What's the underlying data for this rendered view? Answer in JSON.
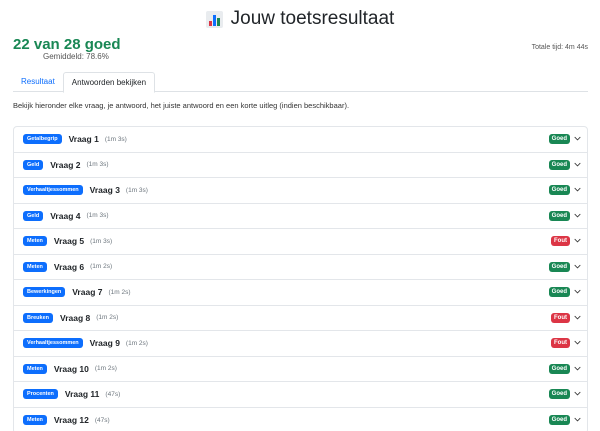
{
  "header": {
    "title": "Jouw toetsresultaat",
    "icon": "bar-chart-icon",
    "score_text": "22 van 28 goed",
    "average_text": "Gemiddeld: 78.6%",
    "total_time_text": "Totale tijd: 4m 44s"
  },
  "tabs": [
    {
      "label": "Resultaat",
      "active": false
    },
    {
      "label": "Antwoorden bekijken",
      "active": true
    }
  ],
  "intro_text": "Bekijk hieronder elke vraag, je antwoord, het juiste antwoord en een korte uitleg (indien beschikbaar).",
  "questions": [
    {
      "category": "Getalbegrip",
      "label": "Vraag 1",
      "time": "(1m 3s)",
      "result": "Goed",
      "correct": true
    },
    {
      "category": "Geld",
      "label": "Vraag 2",
      "time": "(1m 3s)",
      "result": "Goed",
      "correct": true
    },
    {
      "category": "Verhaaltjessommen",
      "label": "Vraag 3",
      "time": "(1m 3s)",
      "result": "Goed",
      "correct": true
    },
    {
      "category": "Geld",
      "label": "Vraag 4",
      "time": "(1m 3s)",
      "result": "Goed",
      "correct": true
    },
    {
      "category": "Meten",
      "label": "Vraag 5",
      "time": "(1m 3s)",
      "result": "Fout",
      "correct": false
    },
    {
      "category": "Meten",
      "label": "Vraag 6",
      "time": "(1m 2s)",
      "result": "Goed",
      "correct": true
    },
    {
      "category": "Bewerkingen",
      "label": "Vraag 7",
      "time": "(1m 2s)",
      "result": "Goed",
      "correct": true
    },
    {
      "category": "Breuken",
      "label": "Vraag 8",
      "time": "(1m 2s)",
      "result": "Fout",
      "correct": false
    },
    {
      "category": "Verhaaltjessommen",
      "label": "Vraag 9",
      "time": "(1m 2s)",
      "result": "Fout",
      "correct": false
    },
    {
      "category": "Meten",
      "label": "Vraag 10",
      "time": "(1m 2s)",
      "result": "Goed",
      "correct": true
    },
    {
      "category": "Procenten",
      "label": "Vraag 11",
      "time": "(47s)",
      "result": "Goed",
      "correct": true
    },
    {
      "category": "Meten",
      "label": "Vraag 12",
      "time": "(47s)",
      "result": "Goed",
      "correct": true
    }
  ],
  "colors": {
    "good": "#198754",
    "bad": "#dc3545",
    "category": "#0d6efd",
    "link": "#0d6efd"
  }
}
